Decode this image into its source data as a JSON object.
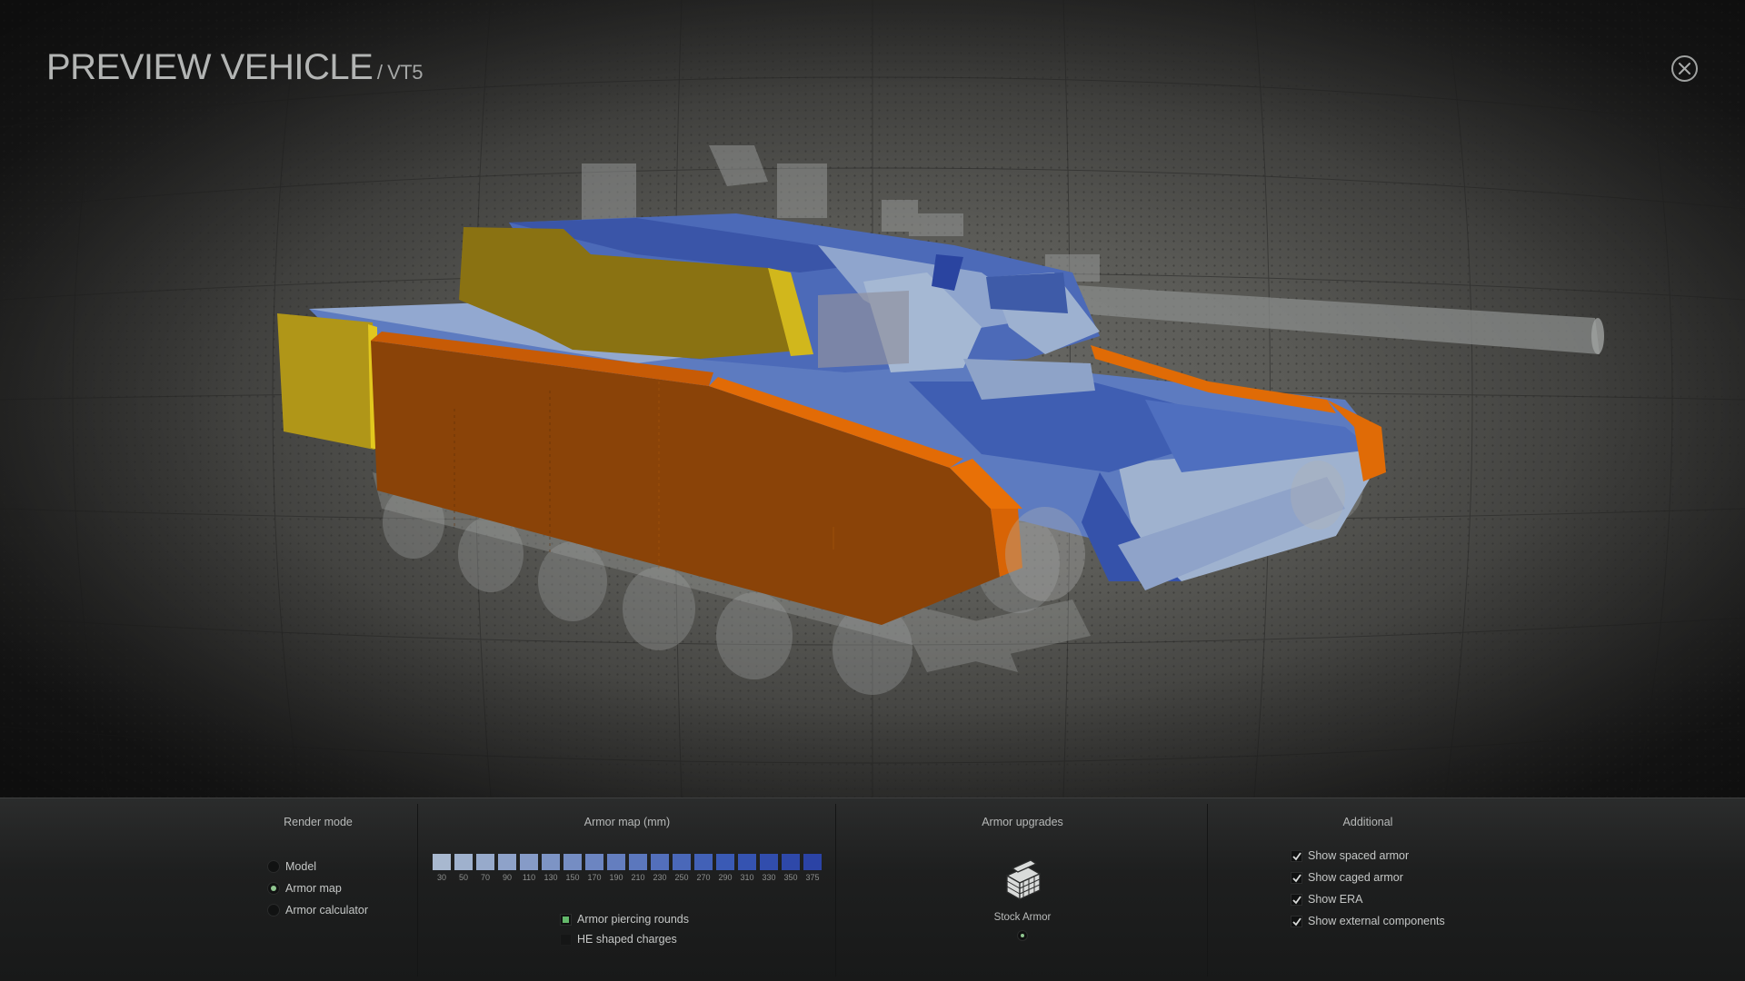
{
  "header": {
    "title": "PREVIEW VEHICLE",
    "subtitle": "/ VT5",
    "close_icon": "close-circle-icon"
  },
  "viewport": {
    "description_icon": "tank-3d-model",
    "colors": {
      "spaced_armor": "#c08a12",
      "side_skirt": "#8a4308",
      "skirt_edge": "#e86f06",
      "armor_low": "#a6b7cf",
      "armor_high": "#2f4aa6",
      "ghost": "#9a9c9b"
    }
  },
  "bottom_panel": {
    "render_mode": {
      "title": "Render mode",
      "options": [
        {
          "label": "Model",
          "selected": false
        },
        {
          "label": "Armor map",
          "selected": true
        },
        {
          "label": "Armor calculator",
          "selected": false
        }
      ]
    },
    "armor_map": {
      "title": "Armor map (mm)",
      "scale": [
        {
          "label": "30",
          "color": "#a8b8cf"
        },
        {
          "label": "50",
          "color": "#9fb1cd"
        },
        {
          "label": "70",
          "color": "#97aacb"
        },
        {
          "label": "90",
          "color": "#8ea2c9"
        },
        {
          "label": "110",
          "color": "#869bc7"
        },
        {
          "label": "130",
          "color": "#7d94c5"
        },
        {
          "label": "150",
          "color": "#758dc3"
        },
        {
          "label": "170",
          "color": "#6c85c1"
        },
        {
          "label": "190",
          "color": "#647ebf"
        },
        {
          "label": "210",
          "color": "#5b77bd"
        },
        {
          "label": "230",
          "color": "#536fbb"
        },
        {
          "label": "250",
          "color": "#4a68b9"
        },
        {
          "label": "270",
          "color": "#4261b7"
        },
        {
          "label": "290",
          "color": "#3a5ab5"
        },
        {
          "label": "310",
          "color": "#3553b1"
        },
        {
          "label": "330",
          "color": "#314dad"
        },
        {
          "label": "350",
          "color": "#2e48a9"
        },
        {
          "label": "375",
          "color": "#2b43a5"
        }
      ],
      "ammo_types": [
        {
          "label": "Armor piercing rounds",
          "selected": true
        },
        {
          "label": "HE shaped charges",
          "selected": false
        }
      ]
    },
    "armor_upgrades": {
      "title": "Armor upgrades",
      "items": [
        {
          "label": "Stock Armor",
          "icon": "armor-plates-icon",
          "selected": true
        }
      ]
    },
    "additional": {
      "title": "Additional",
      "options": [
        {
          "label": "Show spaced armor",
          "checked": true
        },
        {
          "label": "Show caged armor",
          "checked": true
        },
        {
          "label": "Show ERA",
          "checked": true
        },
        {
          "label": "Show external components",
          "checked": true
        }
      ]
    }
  }
}
